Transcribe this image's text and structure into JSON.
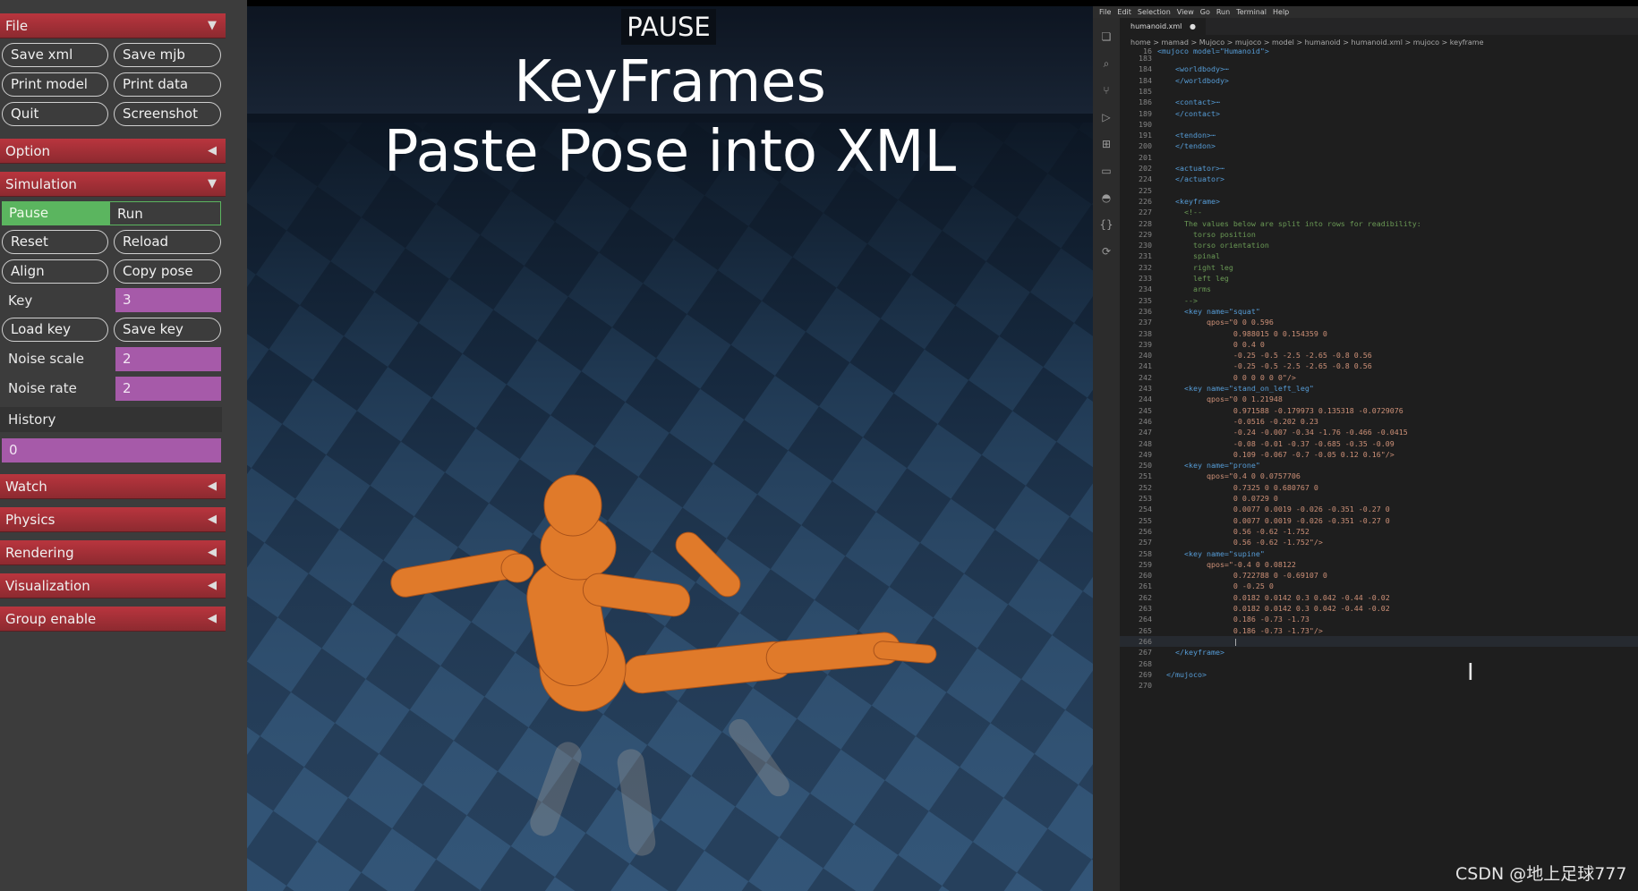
{
  "left_panel": {
    "file": {
      "header": "File",
      "arrow": "▼",
      "buttons": [
        "Save xml",
        "Save mjb",
        "Print model",
        "Print data",
        "Quit",
        "Screenshot"
      ]
    },
    "option": {
      "header": "Option",
      "arrow": "◀"
    },
    "simulation": {
      "header": "Simulation",
      "arrow": "▼",
      "pause_label": "Pause",
      "run_label": "Run",
      "buttons": [
        "Reset",
        "Reload",
        "Align",
        "Copy pose",
        "Load key",
        "Save key"
      ],
      "key_label": "Key",
      "key_value": "3",
      "noise_scale_label": "Noise scale",
      "noise_scale_value": "2",
      "noise_rate_label": "Noise rate",
      "noise_rate_value": "2",
      "history_label": "History",
      "history_value": "0"
    },
    "collapsed_sections": [
      {
        "header": "Watch",
        "arrow": "◀"
      },
      {
        "header": "Physics",
        "arrow": "◀"
      },
      {
        "header": "Rendering",
        "arrow": "◀"
      },
      {
        "header": "Visualization",
        "arrow": "◀"
      },
      {
        "header": "Group enable",
        "arrow": "◀"
      }
    ]
  },
  "viewport": {
    "status": "PAUSE",
    "title_line1": "KeyFrames",
    "title_line2": "Paste Pose into XML",
    "model_color": "#e07a2a"
  },
  "editor": {
    "menu": [
      "File",
      "Edit",
      "Selection",
      "View",
      "Go",
      "Run",
      "Terminal",
      "Help"
    ],
    "tab": "humanoid.xml",
    "breadcrumb": "home > mamad > Mujoco > mujoco > model > humanoid > humanoid.xml > mujoco > keyframe",
    "sticky_line_number": "16",
    "sticky_line_text": "<mujoco model=\"Humanoid\">",
    "lines": [
      {
        "n": "183",
        "t": "",
        "k": "tag"
      },
      {
        "n": "184",
        "t": "  <worldbody>⋯",
        "k": "fold"
      },
      {
        "n": "184",
        "t": "  </worldbody>",
        "k": "tag"
      },
      {
        "n": "185",
        "t": "",
        "k": "tag"
      },
      {
        "n": "186",
        "t": "  <contact>⋯",
        "k": "fold"
      },
      {
        "n": "189",
        "t": "  </contact>",
        "k": "tag"
      },
      {
        "n": "190",
        "t": "",
        "k": "tag"
      },
      {
        "n": "191",
        "t": "  <tendon>⋯",
        "k": "fold"
      },
      {
        "n": "200",
        "t": "  </tendon>",
        "k": "tag"
      },
      {
        "n": "201",
        "t": "",
        "k": "tag"
      },
      {
        "n": "202",
        "t": "  <actuator>⋯",
        "k": "fold"
      },
      {
        "n": "224",
        "t": "  </actuator>",
        "k": "tag"
      },
      {
        "n": "225",
        "t": "",
        "k": "tag"
      },
      {
        "n": "226",
        "t": "  <keyframe>",
        "k": "tag"
      },
      {
        "n": "227",
        "t": "    <!--",
        "k": "cmt"
      },
      {
        "n": "228",
        "t": "    The values below are split into rows for readibility:",
        "k": "cmt"
      },
      {
        "n": "229",
        "t": "      torso position",
        "k": "cmt"
      },
      {
        "n": "230",
        "t": "      torso orientation",
        "k": "cmt"
      },
      {
        "n": "231",
        "t": "      spinal",
        "k": "cmt"
      },
      {
        "n": "232",
        "t": "      right leg",
        "k": "cmt"
      },
      {
        "n": "233",
        "t": "      left leg",
        "k": "cmt"
      },
      {
        "n": "234",
        "t": "      arms",
        "k": "cmt"
      },
      {
        "n": "235",
        "t": "    -->",
        "k": "cmt"
      },
      {
        "n": "236",
        "t": "    <key name=\"squat\"",
        "k": "tag"
      },
      {
        "n": "237",
        "t": "         qpos=\"0 0 0.596",
        "k": "val"
      },
      {
        "n": "238",
        "t": "               0.988015 0 0.154359 0",
        "k": "val"
      },
      {
        "n": "239",
        "t": "               0 0.4 0",
        "k": "val"
      },
      {
        "n": "240",
        "t": "               -0.25 -0.5 -2.5 -2.65 -0.8 0.56",
        "k": "val"
      },
      {
        "n": "241",
        "t": "               -0.25 -0.5 -2.5 -2.65 -0.8 0.56",
        "k": "val"
      },
      {
        "n": "242",
        "t": "               0 0 0 0 0 0\"/>",
        "k": "val"
      },
      {
        "n": "243",
        "t": "    <key name=\"stand_on_left_leg\"",
        "k": "tag"
      },
      {
        "n": "244",
        "t": "         qpos=\"0 0 1.21948",
        "k": "val"
      },
      {
        "n": "245",
        "t": "               0.971588 -0.179973 0.135318 -0.0729076",
        "k": "val"
      },
      {
        "n": "246",
        "t": "               -0.0516 -0.202 0.23",
        "k": "val"
      },
      {
        "n": "247",
        "t": "               -0.24 -0.007 -0.34 -1.76 -0.466 -0.0415",
        "k": "val"
      },
      {
        "n": "248",
        "t": "               -0.08 -0.01 -0.37 -0.685 -0.35 -0.09",
        "k": "val"
      },
      {
        "n": "249",
        "t": "               0.109 -0.067 -0.7 -0.05 0.12 0.16\"/>",
        "k": "val"
      },
      {
        "n": "250",
        "t": "    <key name=\"prone\"",
        "k": "tag"
      },
      {
        "n": "251",
        "t": "         qpos=\"0.4 0 0.0757706",
        "k": "val"
      },
      {
        "n": "252",
        "t": "               0.7325 0 0.680767 0",
        "k": "val"
      },
      {
        "n": "253",
        "t": "               0 0.0729 0",
        "k": "val"
      },
      {
        "n": "254",
        "t": "               0.0077 0.0019 -0.026 -0.351 -0.27 0",
        "k": "val"
      },
      {
        "n": "255",
        "t": "               0.0077 0.0019 -0.026 -0.351 -0.27 0",
        "k": "val"
      },
      {
        "n": "256",
        "t": "               0.56 -0.62 -1.752",
        "k": "val"
      },
      {
        "n": "257",
        "t": "               0.56 -0.62 -1.752\"/>",
        "k": "val"
      },
      {
        "n": "258",
        "t": "    <key name=\"supine\"",
        "k": "tag"
      },
      {
        "n": "259",
        "t": "         qpos=\"-0.4 0 0.08122",
        "k": "val"
      },
      {
        "n": "260",
        "t": "               0.722788 0 -0.69107 0",
        "k": "val"
      },
      {
        "n": "261",
        "t": "               0 -0.25 0",
        "k": "val"
      },
      {
        "n": "262",
        "t": "               0.0182 0.0142 0.3 0.042 -0.44 -0.02",
        "k": "val"
      },
      {
        "n": "263",
        "t": "               0.0182 0.0142 0.3 0.042 -0.44 -0.02",
        "k": "val"
      },
      {
        "n": "264",
        "t": "               0.186 -0.73 -1.73",
        "k": "val"
      },
      {
        "n": "265",
        "t": "               0.186 -0.73 -1.73\"/>",
        "k": "val"
      },
      {
        "n": "266",
        "t": "               |",
        "k": "cur"
      },
      {
        "n": "267",
        "t": "  </keyframe>",
        "k": "tag"
      },
      {
        "n": "268",
        "t": "",
        "k": "tag"
      },
      {
        "n": "269",
        "t": "</mujoco>",
        "k": "tag"
      },
      {
        "n": "270",
        "t": "",
        "k": "tag"
      }
    ]
  },
  "watermark": "CSDN @地上足球777"
}
